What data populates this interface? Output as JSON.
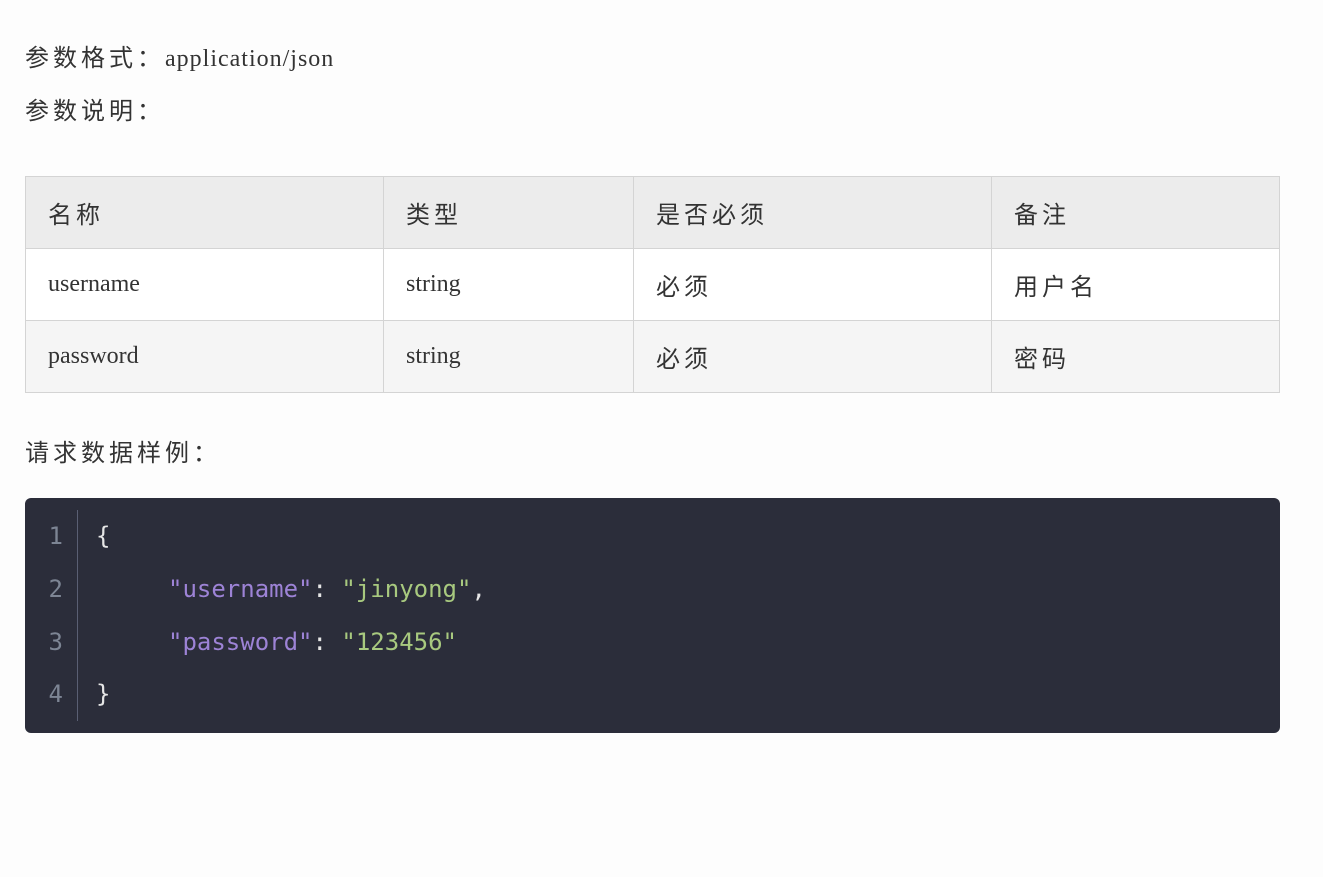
{
  "paramFormat": {
    "label": "参数格式：",
    "value": "application/json"
  },
  "paramDesc": "参数说明：",
  "table": {
    "headers": [
      "名称",
      "类型",
      "是否必须",
      "备注"
    ],
    "rows": [
      {
        "name": "username",
        "type": "string",
        "required": "必须",
        "remark": "用户名"
      },
      {
        "name": "password",
        "type": "string",
        "required": "必须",
        "remark": "密码"
      }
    ]
  },
  "sampleLabel": "请求数据样例：",
  "code": {
    "lines": [
      "1",
      "2",
      "3",
      "4"
    ],
    "open": "{",
    "close": "}",
    "entries": [
      {
        "key": "\"username\"",
        "colon": ": ",
        "value": "\"jinyong\"",
        "comma": ","
      },
      {
        "key": "\"password\"",
        "colon": ": ",
        "value": "\"123456\"",
        "comma": ""
      }
    ]
  }
}
